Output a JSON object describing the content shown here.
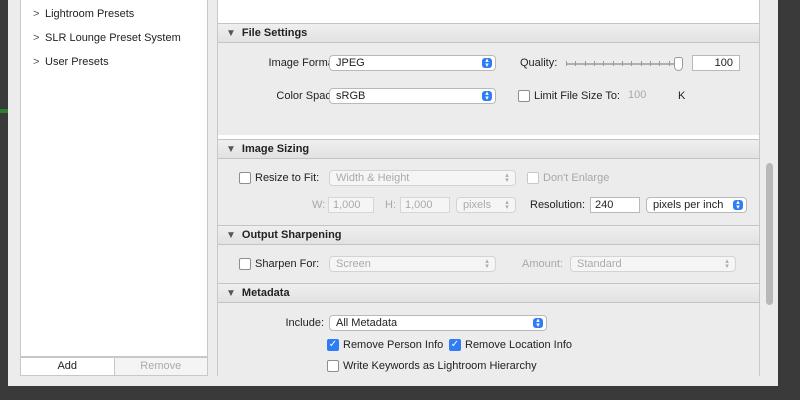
{
  "presets": {
    "items": [
      {
        "label": "Lightroom Presets"
      },
      {
        "label": "SLR Lounge Preset System"
      },
      {
        "label": "User Presets"
      }
    ],
    "add_label": "Add",
    "remove_label": "Remove"
  },
  "file_settings": {
    "title": "File Settings",
    "image_format_label": "Image Format:",
    "image_format_value": "JPEG",
    "quality_label": "Quality:",
    "quality_value": "100",
    "quality_level": 1.0,
    "color_space_label": "Color Space:",
    "color_space_value": "sRGB",
    "limit_label": "Limit File Size To:",
    "limit_value": "100",
    "limit_unit": "K"
  },
  "image_sizing": {
    "title": "Image Sizing",
    "resize_label": "Resize to Fit:",
    "resize_value": "Width & Height",
    "dont_enlarge_label": "Don't Enlarge",
    "w_label": "W:",
    "w_value": "1,000",
    "h_label": "H:",
    "h_value": "1,000",
    "unit_value": "pixels",
    "resolution_label": "Resolution:",
    "resolution_value": "240",
    "resolution_unit": "pixels per inch"
  },
  "output_sharpening": {
    "title": "Output Sharpening",
    "sharpen_label": "Sharpen For:",
    "sharpen_value": "Screen",
    "amount_label": "Amount:",
    "amount_value": "Standard"
  },
  "metadata": {
    "title": "Metadata",
    "include_label": "Include:",
    "include_value": "All Metadata",
    "remove_person_label": "Remove Person Info",
    "remove_location_label": "Remove Location Info",
    "write_keywords_label": "Write Keywords as Lightroom Hierarchy"
  },
  "colors": {
    "accent": "#2f7cf6",
    "panel": "#ececec",
    "frame": "#3a3a3a"
  }
}
